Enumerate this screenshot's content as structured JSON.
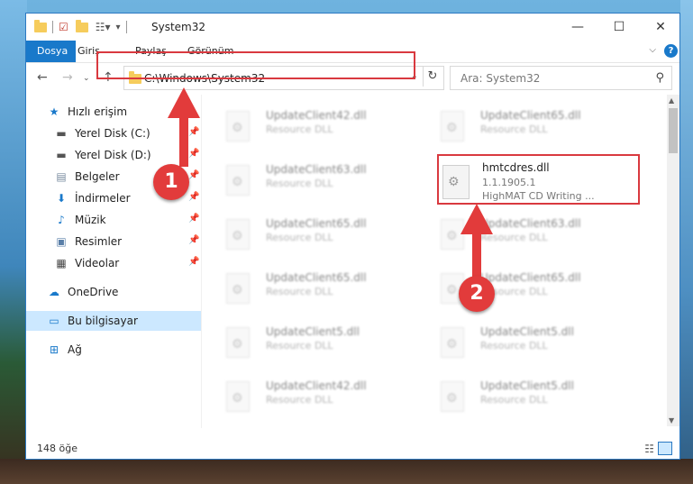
{
  "window": {
    "title": "System32"
  },
  "ribbon": {
    "tabs": [
      "Dosya",
      "Giriş",
      "Paylaş",
      "Görünüm"
    ]
  },
  "nav": {
    "address": "C:\\Windows\\System32",
    "search_placeholder": "Ara: System32"
  },
  "sidebar": {
    "items": [
      {
        "label": "Hızlı erişim"
      },
      {
        "label": "Yerel Disk (C:)"
      },
      {
        "label": "Yerel Disk (D:)"
      },
      {
        "label": "Belgeler"
      },
      {
        "label": "İndirmeler"
      },
      {
        "label": "Müzik"
      },
      {
        "label": "Resimler"
      },
      {
        "label": "Videolar"
      },
      {
        "label": "OneDrive"
      },
      {
        "label": "Bu bilgisayar"
      },
      {
        "label": "Ağ"
      }
    ]
  },
  "files": [
    {
      "name": "UpdateClient42.dll",
      "desc": "Resource DLL"
    },
    {
      "name": "UpdateClient65.dll",
      "desc": "Resource DLL"
    },
    {
      "name": "UpdateClient63.dll",
      "desc": "Resource DLL"
    },
    {
      "name": "hmtcdres.dll",
      "version": "1.1.1905.1",
      "desc": "HighMAT CD Writing ..."
    },
    {
      "name": "UpdateClient65.dll",
      "desc": "Resource DLL"
    },
    {
      "name": "UpdateClient63.dll",
      "desc": "Resource DLL"
    },
    {
      "name": "UpdateClient65.dll",
      "desc": "Resource DLL"
    },
    {
      "name": "UpdateClient65.dll",
      "desc": "Resource DLL"
    },
    {
      "name": "UpdateClient5.dll",
      "desc": "Resource DLL"
    },
    {
      "name": "UpdateClient5.dll",
      "desc": "Resource DLL"
    },
    {
      "name": "UpdateClient42.dll",
      "desc": "Resource DLL"
    },
    {
      "name": "UpdateClient5.dll",
      "desc": "Resource DLL"
    }
  ],
  "status": {
    "count": "148 öğe"
  },
  "annotations": {
    "badge1": "1",
    "badge2": "2"
  },
  "colors": {
    "accent": "#1979ca",
    "highlight": "#d9393f",
    "badge": "#e23b3b"
  }
}
